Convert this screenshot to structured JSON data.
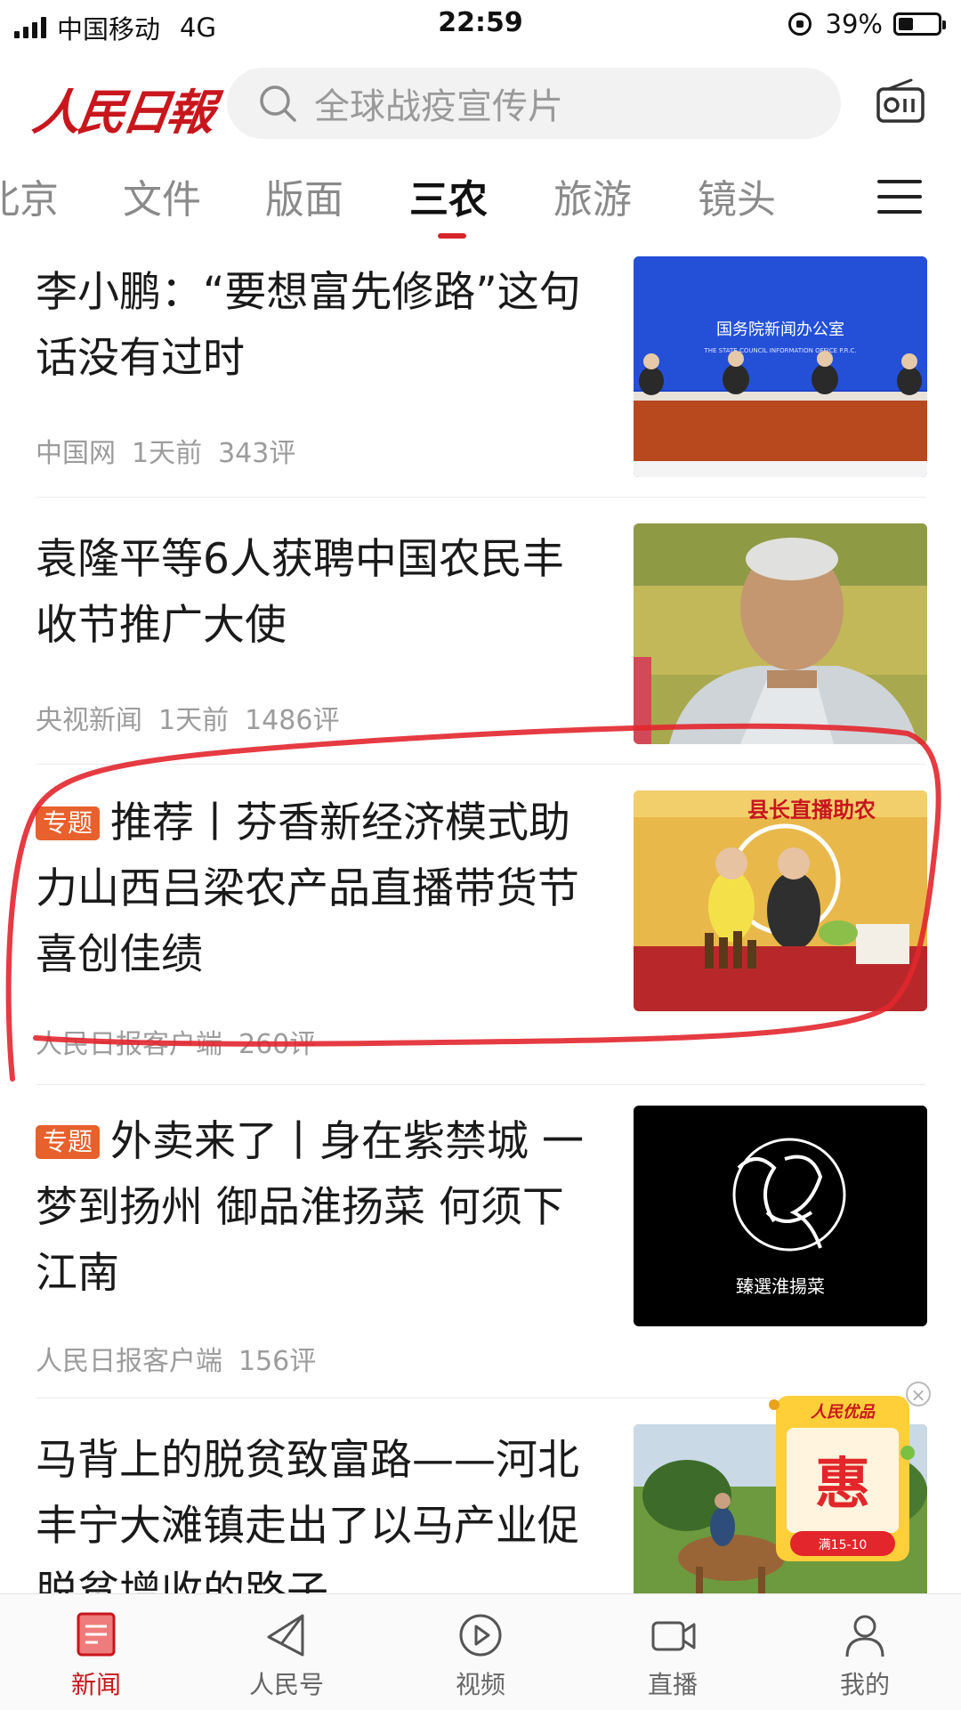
{
  "status_bar": {
    "carrier": "中国移动",
    "network": "4G",
    "time": "22:59",
    "battery": "39%",
    "battery_level": 0.39
  },
  "header": {
    "logo": "人民日報",
    "search_placeholder": "全球战疫宣传片",
    "radio_icon": "radio-icon"
  },
  "tabs": {
    "items": [
      "北京",
      "文件",
      "版面",
      "三农",
      "旅游",
      "镜头"
    ],
    "active": "三农",
    "accent_color": "#d6262b"
  },
  "feed": [
    {
      "title": "李小鹏：“要想富先修路”这句话没有过时",
      "badge": "",
      "source": "中国网",
      "time": "1天前",
      "comments": "343评",
      "thumb_caption": "国务院新闻办公室",
      "thumb_caption_en": "THE STATE COUNCIL INFORMATION OFFICE P.R.C."
    },
    {
      "title": "袁隆平等6人获聘中国农民丰收节推广大使",
      "badge": "",
      "source": "央视新闻",
      "time": "1天前",
      "comments": "1486评"
    },
    {
      "title": "推荐丨芬香新经济模式助力山西吕梁农产品直播带货节 喜创佳绩",
      "badge": "专题",
      "source": "人民日报客户端",
      "time": "",
      "comments": "260评",
      "thumb_caption": "县长直播助农"
    },
    {
      "title": "外卖来了丨身在紫禁城 一梦到扬州 御品淮扬菜 何须下江南",
      "badge": "专题",
      "source": "人民日报客户端",
      "time": "",
      "comments": "156评",
      "thumb_caption": "臻選淮揚菜"
    },
    {
      "title": "马背上的脱贫致富路——河北丰宁大滩镇走出了以马产业促脱贫增收的路子",
      "badge": "",
      "source": "",
      "time": "",
      "comments": ""
    }
  ],
  "promo": {
    "brand": "人民优品",
    "main": "惠",
    "sub": "满15-10"
  },
  "bottom_nav": {
    "items": [
      "新闻",
      "人民号",
      "视频",
      "直播",
      "我的"
    ],
    "active": "新闻",
    "active_color": "#c8161d"
  }
}
